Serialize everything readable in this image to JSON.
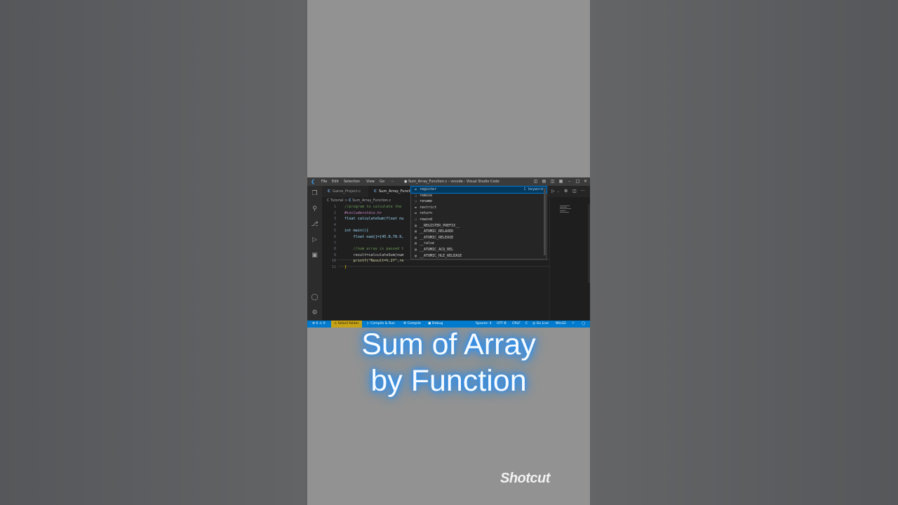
{
  "window": {
    "title": "● Sum_Array_Function.c - vscode - Visual Studio Code",
    "menu": [
      "File",
      "Edit",
      "Selection",
      "View",
      "Go",
      "···"
    ]
  },
  "tabs": [
    {
      "label": "Game_Project.c",
      "active": false
    },
    {
      "label": "Sum_Array_Funct",
      "active": true
    }
  ],
  "breadcrumb": {
    "folder": "C Tutorial",
    "sep": ">",
    "file": "Sum_Array_Function.c"
  },
  "editor": {
    "line_numbers": [
      "1",
      "2",
      "3",
      "4",
      "5",
      "6",
      "7",
      "8",
      "9",
      "10",
      "11"
    ],
    "lines": [
      "//program to calculate the",
      "#include<stdio.h>",
      "float calculateSum(float nu",
      "",
      "int main(){",
      "    float num[]={45.0,78.9,",
      "",
      "    //num array is passed t",
      "    result=calculateSum(num",
      "    printf(\"Result=%.2f\",re",
      "}"
    ]
  },
  "suggestions": [
    {
      "label": "register",
      "hint": "keyword",
      "icon": "keyword-icon"
    },
    {
      "label": "remove",
      "icon": "function-icon"
    },
    {
      "label": "rename",
      "icon": "function-icon"
    },
    {
      "label": "restrict",
      "icon": "keyword-icon"
    },
    {
      "label": "return",
      "icon": "keyword-icon"
    },
    {
      "label": "rewind",
      "icon": "function-icon"
    },
    {
      "label": "__REGISTER_PREFIX__",
      "icon": "snippet-icon"
    },
    {
      "label": "__ATOMIC_RELAXED",
      "icon": "snippet-icon"
    },
    {
      "label": "__ATOMIC_RELEASE",
      "icon": "snippet-icon"
    },
    {
      "label": "__ralse",
      "icon": "snippet-icon"
    },
    {
      "label": "__ATOMIC_ACQ_REL",
      "icon": "snippet-icon"
    },
    {
      "label": "__ATOMIC_HLE_RELEASE",
      "icon": "snippet-icon"
    }
  ],
  "statusbar": {
    "problems": "⊗ 0 ⚠ 0",
    "select_folder": "⚠ Select folder.",
    "compile_run": "▷ Compile & Run",
    "compile": "⚙ Compile",
    "debug": "▣ Debug",
    "spaces": "Spaces: 4",
    "encoding": "UTF-8",
    "eol": "CRLF",
    "language": "C",
    "go_live": "◎ Go Live",
    "platform": "Win32"
  },
  "caption": {
    "line1": "Sum of Array",
    "line2": "by Function"
  },
  "watermark": "Shotcut",
  "colors": {
    "statusbar": "#007acc",
    "caption_glow": "#1e8fff",
    "selection": "#04395e"
  }
}
